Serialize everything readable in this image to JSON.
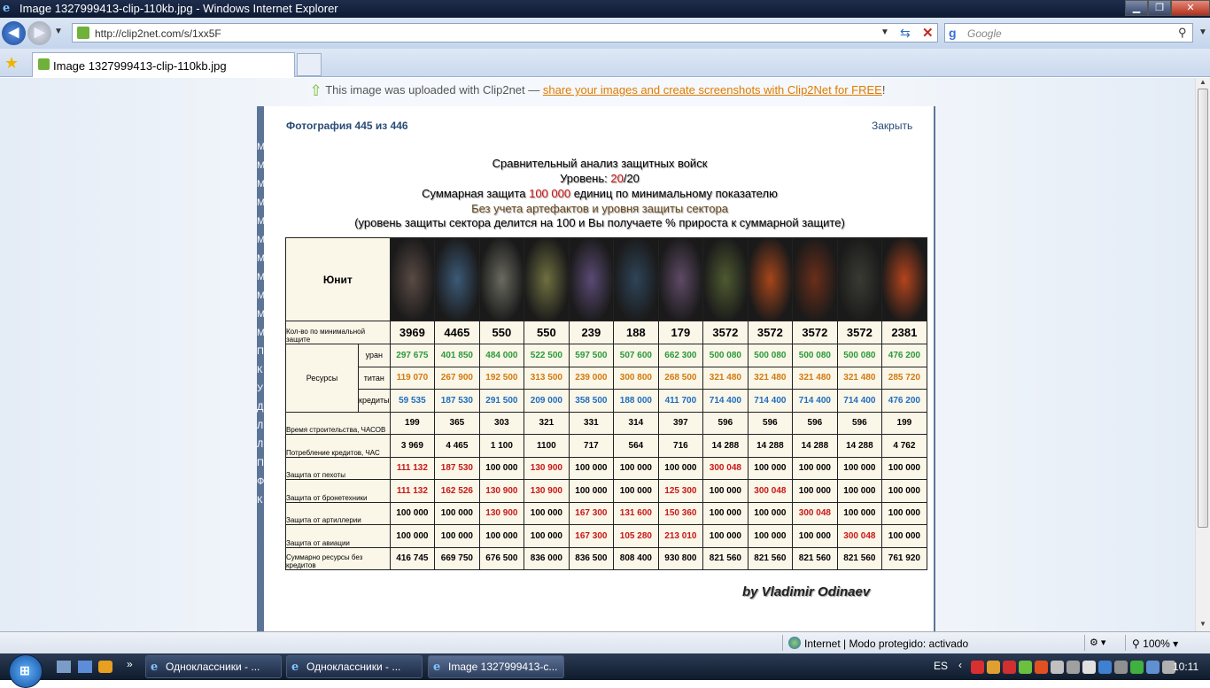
{
  "window": {
    "title": "Image 1327999413-clip-110kb.jpg - Windows Internet Explorer"
  },
  "address": {
    "url": "http://clip2net.com/s/1xx5F"
  },
  "search": {
    "placeholder": "Google"
  },
  "tabs": [
    {
      "label": "Image 1327999413-clip-110kb.jpg"
    }
  ],
  "banner": {
    "prefix": "This image was uploaded with Clip2net — ",
    "link": "share your images and create screenshots with Clip2Net for FREE",
    "suffix": "!"
  },
  "photo": {
    "counter": "Фотография 445 из 446",
    "close": "Закрыть"
  },
  "left_letters": [
    "М",
    "М",
    "М",
    "М",
    "М",
    "М",
    "М",
    "М",
    "М",
    "М",
    "М",
    "",
    "П",
    "",
    "К",
    "У",
    "Д",
    "Л",
    "Л",
    "П",
    "Ф",
    "К"
  ],
  "infographic": {
    "line1": "Сравнительный анализ защитных войск",
    "line2_pre": "Уровень: ",
    "line2_red": "20",
    "line2_post": "/20",
    "line3_pre": "Суммарная защита ",
    "line3_red": "100 000",
    "line3_post": " единиц по минимальному показателю",
    "line4": "Без учета артефактов и уровня защиты сектора",
    "line5": "(уровень защиты сектора делится на 100 и Вы получаете % прироста к суммарной защите)",
    "byline": "by Vladimir Odinaev"
  },
  "table": {
    "unit_header": "Юнит",
    "unit_colors": [
      "#5a4a44",
      "#3c5a78",
      "#6a6a60",
      "#6f7040",
      "#5a4a74",
      "#2e4458",
      "#5e4a66",
      "#4e5a30",
      "#a6461a",
      "#6a2e1a",
      "#3a3a34",
      "#b4441c"
    ],
    "min_count_label": "Кол-во по минимальной защите",
    "min_count": [
      "3969",
      "4465",
      "550",
      "550",
      "239",
      "188",
      "179",
      "3572",
      "3572",
      "3572",
      "3572",
      "2381"
    ],
    "resources_label": "Ресурсы",
    "resources": [
      {
        "label": "уран",
        "color": "#2a9a3a",
        "values": [
          "297 675",
          "401 850",
          "484 000",
          "522 500",
          "597 500",
          "507 600",
          "662 300",
          "500 080",
          "500 080",
          "500 080",
          "500 080",
          "476 200"
        ]
      },
      {
        "label": "титан",
        "color": "#d27a10",
        "values": [
          "119 070",
          "267 900",
          "192 500",
          "313 500",
          "239 000",
          "300 800",
          "268 500",
          "321 480",
          "321 480",
          "321 480",
          "321 480",
          "285 720"
        ]
      },
      {
        "label": "кредиты",
        "color": "#1e6ec0",
        "values": [
          "59 535",
          "187 530",
          "291 500",
          "209 000",
          "358 500",
          "188 000",
          "411 700",
          "714 400",
          "714 400",
          "714 400",
          "714 400",
          "476 200"
        ]
      }
    ],
    "rows": [
      {
        "label": "Время строительства, ЧАСОВ",
        "values": [
          "199",
          "365",
          "303",
          "321",
          "331",
          "314",
          "397",
          "596",
          "596",
          "596",
          "596",
          "199"
        ],
        "red": []
      },
      {
        "label": "Потребление кредитов, ЧАС",
        "values": [
          "3 969",
          "4 465",
          "1 100",
          "1100",
          "717",
          "564",
          "716",
          "14 288",
          "14 288",
          "14 288",
          "14 288",
          "4 762"
        ],
        "red": []
      },
      {
        "label": "Защита от пехоты",
        "values": [
          "111 132",
          "187 530",
          "100 000",
          "130 900",
          "100 000",
          "100 000",
          "100 000",
          "300 048",
          "100 000",
          "100 000",
          "100 000",
          "100 000"
        ],
        "red": [
          0,
          1,
          3,
          7
        ]
      },
      {
        "label": "Защита от бронетехники",
        "values": [
          "111 132",
          "162 526",
          "130 900",
          "130 900",
          "100 000",
          "100 000",
          "125 300",
          "100 000",
          "300 048",
          "100 000",
          "100 000",
          "100 000"
        ],
        "red": [
          0,
          1,
          2,
          3,
          6,
          8
        ]
      },
      {
        "label": "Защита от артиллерии",
        "values": [
          "100 000",
          "100 000",
          "130 900",
          "100 000",
          "167 300",
          "131 600",
          "150 360",
          "100 000",
          "100 000",
          "300 048",
          "100 000",
          "100 000"
        ],
        "red": [
          2,
          4,
          5,
          6,
          9
        ]
      },
      {
        "label": "Защита от авиации",
        "values": [
          "100 000",
          "100 000",
          "100 000",
          "100 000",
          "167 300",
          "105 280",
          "213 010",
          "100 000",
          "100 000",
          "100 000",
          "300 048",
          "100 000"
        ],
        "red": [
          4,
          5,
          6,
          10
        ]
      },
      {
        "label": "Суммарно ресурсы без кредитов",
        "values": [
          "416 745",
          "669 750",
          "676 500",
          "836 000",
          "836 500",
          "808 400",
          "930 800",
          "821 560",
          "821 560",
          "821 560",
          "821 560",
          "761 920"
        ],
        "red": []
      }
    ],
    "red_color": "#c81818"
  },
  "status": {
    "zone": "Internet | Modo protegido: activado",
    "zoom": "100%"
  },
  "taskbar": {
    "buttons": [
      {
        "label": "Одноклассники - ..."
      },
      {
        "label": "Одноклассники - ..."
      },
      {
        "label": "Image 1327999413-c..."
      }
    ],
    "lang": "ES",
    "clock": "10:11"
  }
}
